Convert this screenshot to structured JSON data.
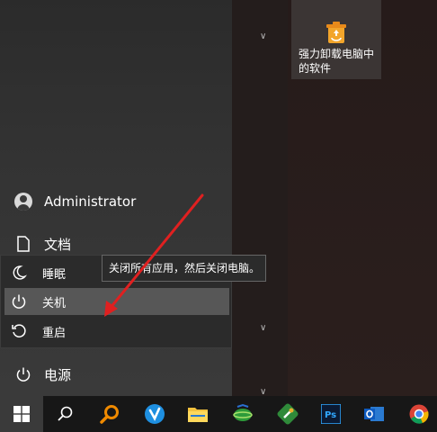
{
  "desktop": {
    "app_tile": {
      "label": "强力卸载电脑中的软件",
      "icon": "recycle-uninstall-icon"
    }
  },
  "start_menu": {
    "user": {
      "name": "Administrator",
      "icon": "user-avatar-icon"
    },
    "documents": {
      "label": "文档",
      "icon": "document-icon"
    },
    "power": {
      "label": "电源",
      "icon": "power-icon"
    }
  },
  "power_flyout": {
    "items": [
      {
        "label": "睡眠",
        "icon": "moon-icon"
      },
      {
        "label": "关机",
        "icon": "power-icon",
        "highlighted": true
      },
      {
        "label": "重启",
        "icon": "restart-icon"
      }
    ],
    "tooltip": "关闭所有应用，然后关闭电脑。"
  },
  "taskbar": {
    "items": [
      {
        "name": "start",
        "icon": "windows-logo-icon"
      },
      {
        "name": "search",
        "icon": "search-icon"
      },
      {
        "name": "magnifier-app",
        "icon": "orange-magnifier-icon"
      },
      {
        "name": "vpn-app",
        "icon": "blue-v-icon"
      },
      {
        "name": "file-explorer",
        "icon": "folder-icon"
      },
      {
        "name": "network-app",
        "icon": "green-globe-icon"
      },
      {
        "name": "tool-app",
        "icon": "green-wrench-icon"
      },
      {
        "name": "photoshop",
        "icon": "photoshop-icon",
        "text": "Ps"
      },
      {
        "name": "outlook",
        "icon": "outlook-icon"
      },
      {
        "name": "chrome",
        "icon": "chrome-icon"
      }
    ]
  },
  "colors": {
    "annotation_arrow": "#e02020",
    "highlight": "#575757",
    "flyout_background": "#2b2b2b"
  }
}
